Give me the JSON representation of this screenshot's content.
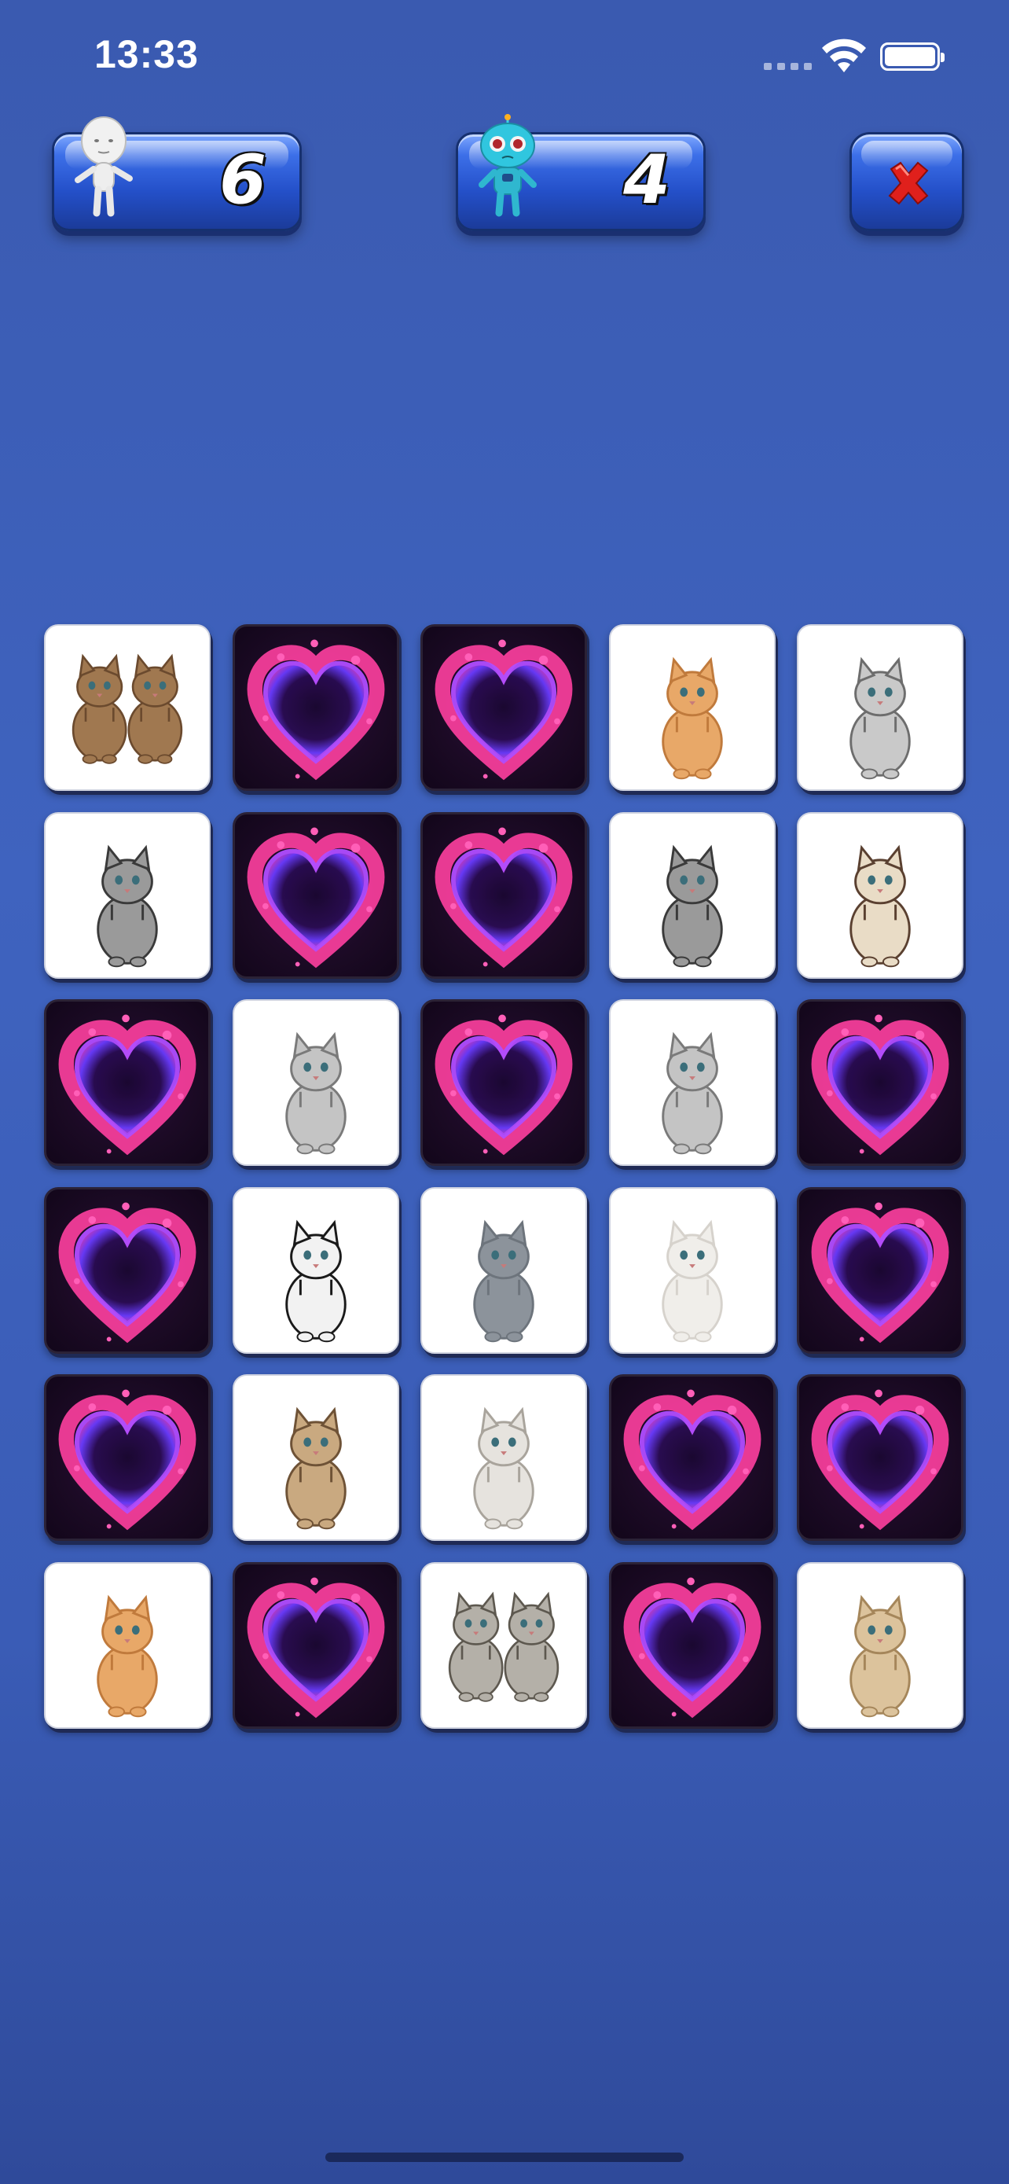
{
  "status_bar": {
    "time": "13:33"
  },
  "scoreboard": {
    "player": {
      "label": "player",
      "score": "6",
      "avatar_icon": "player-avatar-icon"
    },
    "opponent": {
      "label": "robot",
      "score": "4",
      "avatar_icon": "robot-avatar-icon"
    },
    "close_icon": "close-x-icon"
  },
  "board": {
    "columns": 5,
    "rows": 6,
    "cards": [
      {
        "state": "face",
        "image": "two-tabby-kittens"
      },
      {
        "state": "back",
        "image": "heart-card-back"
      },
      {
        "state": "back",
        "image": "heart-card-back"
      },
      {
        "state": "face",
        "image": "orange-fluffy-kitten"
      },
      {
        "state": "face",
        "image": "spotted-bengal-cat-standing"
      },
      {
        "state": "face",
        "image": "gray-fluffy-kitten"
      },
      {
        "state": "back",
        "image": "heart-card-back"
      },
      {
        "state": "back",
        "image": "heart-card-back"
      },
      {
        "state": "face",
        "image": "gray-fluffy-kitten"
      },
      {
        "state": "face",
        "image": "siamese-cat"
      },
      {
        "state": "back",
        "image": "heart-card-back"
      },
      {
        "state": "face",
        "image": "silver-tabby-cat-sitting"
      },
      {
        "state": "back",
        "image": "heart-card-back"
      },
      {
        "state": "face",
        "image": "silver-tabby-cat-sitting"
      },
      {
        "state": "back",
        "image": "heart-card-back"
      },
      {
        "state": "back",
        "image": "heart-card-back"
      },
      {
        "state": "face",
        "image": "black-white-kitten"
      },
      {
        "state": "face",
        "image": "gray-british-shorthair"
      },
      {
        "state": "face",
        "image": "white-persian-cat"
      },
      {
        "state": "back",
        "image": "heart-card-back"
      },
      {
        "state": "back",
        "image": "heart-card-back"
      },
      {
        "state": "face",
        "image": "tabby-kitten-sitting"
      },
      {
        "state": "face",
        "image": "white-longhair-cat"
      },
      {
        "state": "back",
        "image": "heart-card-back"
      },
      {
        "state": "back",
        "image": "heart-card-back"
      },
      {
        "state": "face",
        "image": "orange-fluffy-kitten"
      },
      {
        "state": "back",
        "image": "heart-card-back"
      },
      {
        "state": "face",
        "image": "two-gray-tabby-kittens"
      },
      {
        "state": "back",
        "image": "heart-card-back"
      },
      {
        "state": "face",
        "image": "cream-tabby-cat"
      }
    ]
  },
  "colors": {
    "background": "#3f63bf",
    "panel": "#2450c9",
    "heart_pink": "#ff3fa0",
    "heart_purple": "#6a3cff",
    "close_red": "#e0201c"
  }
}
